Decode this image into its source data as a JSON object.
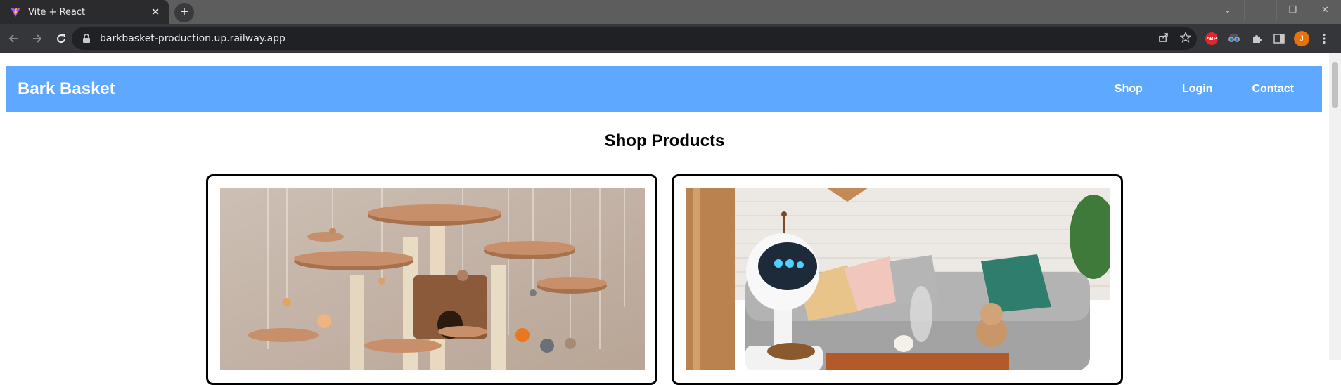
{
  "browser": {
    "tab_title": "Vite + React",
    "tab_close": "✕",
    "new_tab": "+",
    "url": "barkbasket-production.up.railway.app",
    "profile_initial": "J",
    "abp_label": "ABP",
    "window_controls": {
      "tab_search": "⌄",
      "minimize": "—",
      "restore": "❐",
      "close": "✕"
    }
  },
  "site": {
    "brand": "Bark Basket",
    "nav": [
      "Shop",
      "Login",
      "Contact"
    ],
    "section_title": "Shop Products",
    "products": [
      {
        "image": "cat-tree-photo"
      },
      {
        "image": "pet-robot-feeder-photo"
      }
    ]
  },
  "colors": {
    "header_bg": "#5ea8ff",
    "card_border": "#000000"
  }
}
